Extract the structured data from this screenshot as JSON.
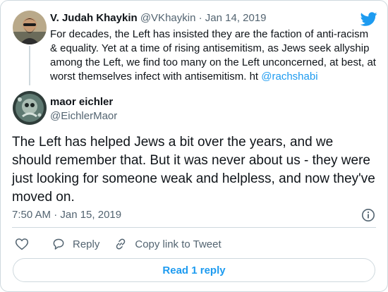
{
  "parent_tweet": {
    "author_name": "V. Judah Khaykin",
    "author_handle": "@VKhaykin",
    "separator": "·",
    "date": "Jan 14, 2019",
    "text_prefix": "For decades, the Left has insisted they are the faction of anti-racism & equality. Yet at a time of rising antisemitism, as Jews seek allyship among the Left, we find too many on the Left unconcerned, at best, at worst themselves infect with antisemitism. ht ",
    "mention": "@rachshabi"
  },
  "reply_tweet": {
    "author_name": "maor eichler",
    "author_handle": "@EichlerMaor",
    "text": "The Left has helped Jews a bit over the years, and we should remember that. But it was never about us - they were just looking for someone weak and helpless, and now they've moved on.",
    "timestamp": "7:50 AM · Jan 15, 2019"
  },
  "actions": {
    "reply_label": "Reply",
    "copy_link_label": "Copy link to Tweet"
  },
  "read_replies_label": "Read 1 reply",
  "icons": {
    "brand": "twitter-bird-icon",
    "like": "heart-icon",
    "reply": "speech-bubble-icon",
    "copy": "link-icon",
    "info": "info-icon"
  },
  "colors": {
    "accent": "#1d9bf0",
    "secondary_text": "#536471",
    "border": "#cfd9de"
  }
}
